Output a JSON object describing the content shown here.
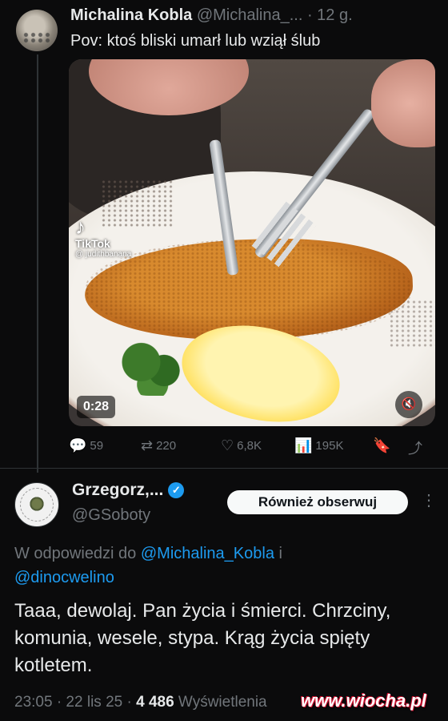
{
  "tweet1": {
    "author_name": "Michalina Kobla",
    "author_handle": "@Michalina_...",
    "time": "· 12 g.",
    "text": "Pov: ktoś bliski umarł lub wziął ślub",
    "media": {
      "overlay_logo": "♪",
      "overlay_brand": "TikTok",
      "overlay_user": "@ judithbanana",
      "duration": "0:28",
      "mute_icon": "speaker-muted-icon"
    },
    "actions": {
      "replies": "59",
      "reposts": "220",
      "likes": "6,8K",
      "views": "195K"
    }
  },
  "tweet2": {
    "author_name": "Grzegorz,...",
    "author_handle": "@GSoboty",
    "follow_label": "Również obserwuj",
    "reply_prefix": "W odpowiedzi do",
    "reply_mention1": "@Michalina_Kobla",
    "reply_and": "i",
    "reply_mention2": "@dinocwelino",
    "text": "Taaa, dewolaj. Pan życia i śmierci. Chrzciny, komunia, wesele, stypa. Krąg życia spięty kotletem.",
    "time": "23:05 · 22 lis 25 ·",
    "views_count": "4 486",
    "views_label": "Wyświetlenia"
  },
  "watermark": "www.wiocha.pl",
  "colors": {
    "background": "#0b0b0c",
    "text": "#e7e9ea",
    "muted": "#71767b",
    "accent": "#1d9bf0",
    "divider": "#2f3336"
  }
}
